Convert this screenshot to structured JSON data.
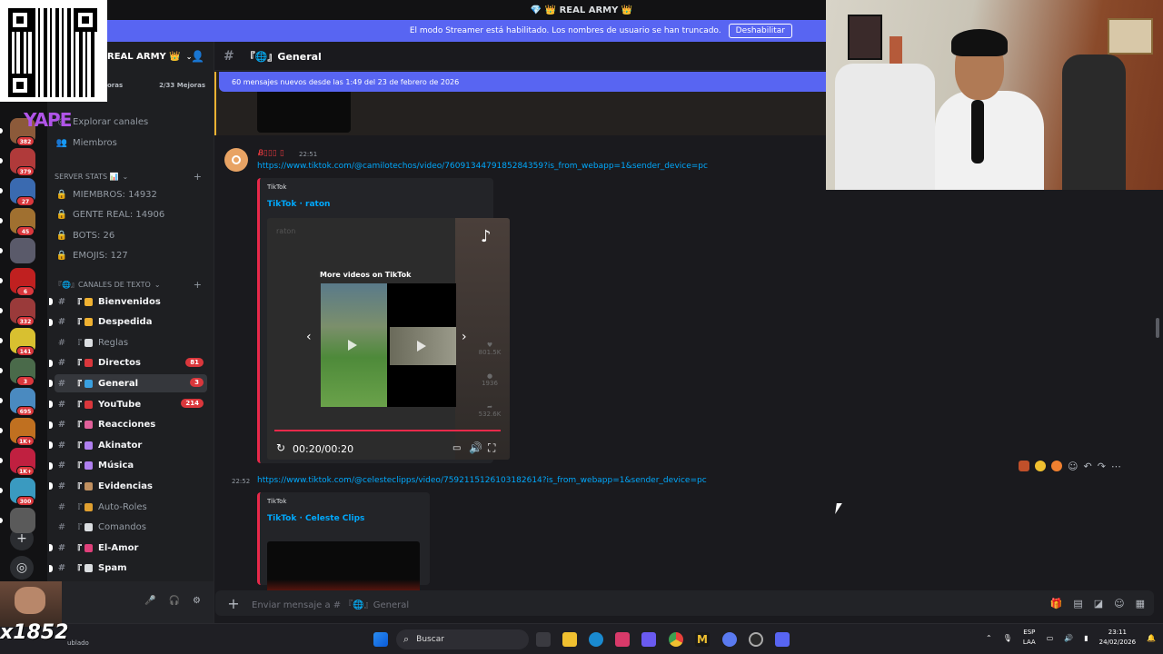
{
  "window": {
    "title": "💎 👑 REAL ARMY 👑"
  },
  "streamer": {
    "message": "El modo Streamer está habilitado. Los nombres de usuario se han truncado.",
    "button": "Deshabilitar"
  },
  "overlay": {
    "brand": "YAPE",
    "viewer_name": "x1852",
    "status_tail": "ublado"
  },
  "server": {
    "name": "REAL ARMY 👑",
    "boost_left": "oras",
    "boost_right": "2/33 Mejoras"
  },
  "servers": [
    {
      "badge": "382",
      "color": "#8c5a3a"
    },
    {
      "badge": "379",
      "color": "#b03a3a"
    },
    {
      "badge": "27",
      "color": "#3a6ab0"
    },
    {
      "badge": "45",
      "color": "#a07030"
    },
    {
      "badge": "",
      "color": "#5a5a6a"
    },
    {
      "badge": "6",
      "color": "#c02020"
    },
    {
      "badge": "332",
      "color": "#9a3a3a"
    },
    {
      "badge": "141",
      "color": "#d8c030"
    },
    {
      "badge": "3",
      "color": "#4a6a4a"
    },
    {
      "badge": "695",
      "color": "#4a8ac0"
    },
    {
      "badge": "1K+",
      "color": "#c07020"
    },
    {
      "badge": "1K+",
      "color": "#c02040"
    },
    {
      "badge": "300",
      "color": "#3a9ac0"
    },
    {
      "badge": "",
      "color": "#5a5a5a"
    }
  ],
  "nav": {
    "explore": "Explorar canales",
    "members": "Miembros"
  },
  "categories": {
    "stats": "SERVER STATS 📊",
    "text": "『🌐』CANALES DE TEXTO"
  },
  "stats": [
    "MIEMBROS: 14932",
    "GENTE REAL: 14906",
    "BOTS: 26",
    "EMOJIS: 127"
  ],
  "channels": [
    {
      "label": "Bienvenidos",
      "emoji": "#f0b232",
      "bold": true,
      "badge": ""
    },
    {
      "label": "Despedida",
      "emoji": "#f0b232",
      "bold": true,
      "badge": ""
    },
    {
      "label": "Reglas",
      "emoji": "#dbdee1",
      "bold": false,
      "badge": ""
    },
    {
      "label": "Directos",
      "emoji": "#da373c",
      "bold": true,
      "badge": "81"
    },
    {
      "label": "General",
      "emoji": "#3aa0e0",
      "bold": true,
      "badge": "3"
    },
    {
      "label": "YouTube",
      "emoji": "#da373c",
      "bold": true,
      "badge": "214"
    },
    {
      "label": "Reacciones",
      "emoji": "#e0609a",
      "bold": true,
      "badge": ""
    },
    {
      "label": "Akinator",
      "emoji": "#b080f0",
      "bold": true,
      "badge": ""
    },
    {
      "label": "Música",
      "emoji": "#b080f0",
      "bold": true,
      "badge": ""
    },
    {
      "label": "Evidencias",
      "emoji": "#c09060",
      "bold": true,
      "badge": ""
    },
    {
      "label": "Auto-Roles",
      "emoji": "#e0a030",
      "bold": false,
      "badge": ""
    },
    {
      "label": "Comandos",
      "emoji": "#dbdee1",
      "bold": false,
      "badge": ""
    },
    {
      "label": "El-Amor",
      "emoji": "#e0407a",
      "bold": true,
      "badge": ""
    },
    {
      "label": "Spam",
      "emoji": "#dbdee1",
      "bold": true,
      "badge": ""
    }
  ],
  "channel": {
    "name": "『🌐』General",
    "new_messages": "60 mensajes nuevos desde las 1:49 del 23 de febrero de 2026"
  },
  "messages": [
    {
      "author": "Ᏸ▯▯▯ ▯",
      "time": "22:51",
      "link": "https://www.tiktok.com/@camilotechos/video/7609134479185284359?is_from_webapp=1&sender_device=pc",
      "provider": "TikTok",
      "title": "TikTok · raton",
      "more_videos": "More videos on TikTok",
      "video_user": "raton",
      "likes": "801.5K",
      "comments": "1936",
      "shares": "532.6K",
      "timer": "00:20/00:20"
    },
    {
      "time": "22:52",
      "link": "https://www.tiktok.com/@celesteclipps/video/7592115126103182614?is_from_webapp=1&sender_device=pc",
      "provider": "TikTok",
      "title": "TikTok · Celeste Clips"
    }
  ],
  "composer": {
    "placeholder": "Enviar mensaje a # 『🌐』General"
  },
  "taskbar": {
    "search": "Buscar",
    "lang": "ESP",
    "lang2": "LAA",
    "time": "23:11",
    "date": "24/02/2026"
  },
  "colors": {
    "accent": "#5865f2",
    "embed_bar": "#e8294a",
    "link": "#00a8fc",
    "badge": "#da373c"
  }
}
